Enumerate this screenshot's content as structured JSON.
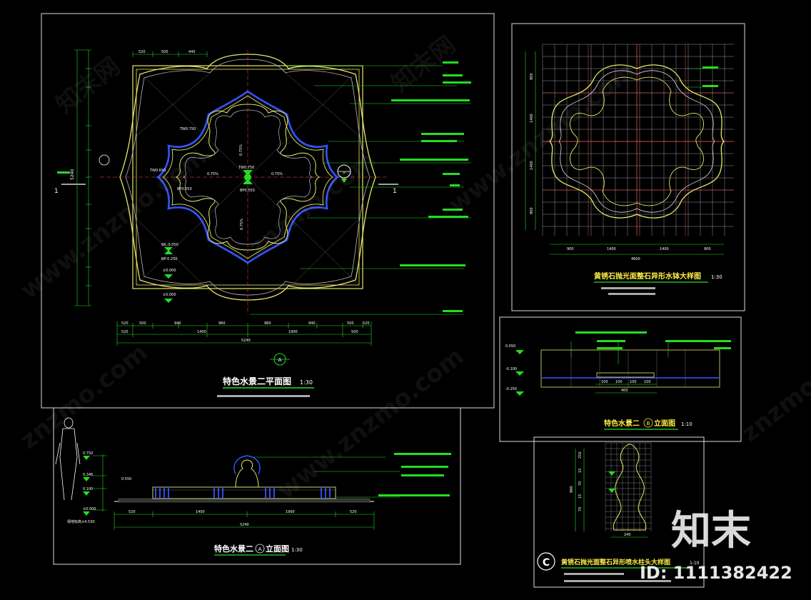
{
  "plan": {
    "title": "特色水景二平面图",
    "scale": "1:30",
    "section_marker": "1",
    "marker_a": "A",
    "top_dims": [
      "520",
      "500",
      "440"
    ],
    "bottom_dims_row1": [
      "520",
      "500",
      "940",
      "960",
      "960",
      "940",
      "500",
      "520"
    ],
    "bottom_dims_row2": [
      "520",
      "1400",
      "1900",
      "500"
    ],
    "bottom_total": "5240",
    "left_total": "5240",
    "slope_left": "0.75%",
    "slope_right": "0.75%",
    "elev_center_top": "TW0.750",
    "elev_center_bottom": "BP0.550",
    "elev_left_top": "TW0.750",
    "elev_left_mid": "TW0.650",
    "elev_left_bp": "BP0.550",
    "elev_bottom_left": "WL-0.050",
    "elev_bottom_bp": "BP-0.250",
    "elev_zero": "±0.000",
    "plus_label": "+",
    "slope_vert_top": "0.75%",
    "slope_vert_bottom": "0.75%"
  },
  "detail_top": {
    "title": "黄锈石抛光面整石异形水钵大样图",
    "scale": "1:30",
    "bottom_dims": [
      "900",
      "1400",
      "1400",
      "900"
    ],
    "total": "4600",
    "left_dims": [
      "900",
      "1400",
      "1400",
      "900"
    ]
  },
  "section_b": {
    "title": "特色水景二",
    "marker": "B",
    "suffix": "立面图",
    "scale": "1:10",
    "elev_1": "0.050",
    "elev_2": "-0.100",
    "elev_3": "-0.250",
    "dims": [
      "100",
      "100",
      "100",
      "100"
    ],
    "dim_total": "400"
  },
  "elevation_a": {
    "title": "特色水景二",
    "marker": "A",
    "suffix": "立面图",
    "scale": "1:30",
    "elev_top": "0.750",
    "elev_mid": "0.550",
    "elev_left": "0.346",
    "elev_low": "0.100",
    "elev_zero": "±0.000",
    "bottom_dims": [
      "520",
      "1400",
      "1900",
      "520"
    ],
    "total": "5240",
    "ground_note": "场地标高±4.530"
  },
  "detail_c": {
    "marker": "C",
    "title": "黄锈石抛光面整石异形喷水柱头大样图",
    "scale": "1:10",
    "dims_left": [
      "250",
      "15",
      "70",
      "15",
      "70",
      "15",
      "70"
    ],
    "dim_total": "980",
    "dim_bottom": "240"
  },
  "watermark": {
    "brand_cn": "知末",
    "id_text": "ID: 1111382422",
    "site_text": "www.znzmo.com",
    "short_site": "znzmo.com",
    "cn_site": "知末网"
  }
}
